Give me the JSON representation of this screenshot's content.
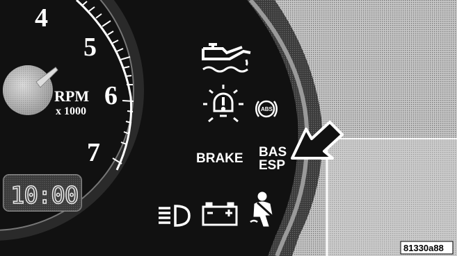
{
  "gauge": {
    "numerals": [
      "4",
      "5",
      "6",
      "7"
    ],
    "unit_label": "RPM",
    "unit_scale": "x 1000"
  },
  "clock": {
    "time": "10:00"
  },
  "indicators": {
    "brake_label": "BRAKE",
    "bas_label": "BAS",
    "esp_label": "ESP",
    "abs_label": "ABS"
  },
  "figure_id": "81330a88",
  "colors": {
    "panel": "#1a1a1a",
    "highlight": "#ffffff",
    "bezel": "#5a5a5a"
  },
  "icons": [
    "oil-pressure-icon",
    "warning-lamp-icon",
    "abs-icon",
    "headlight-icon",
    "battery-icon",
    "seatbelt-icon",
    "pointer-arrow-icon"
  ]
}
